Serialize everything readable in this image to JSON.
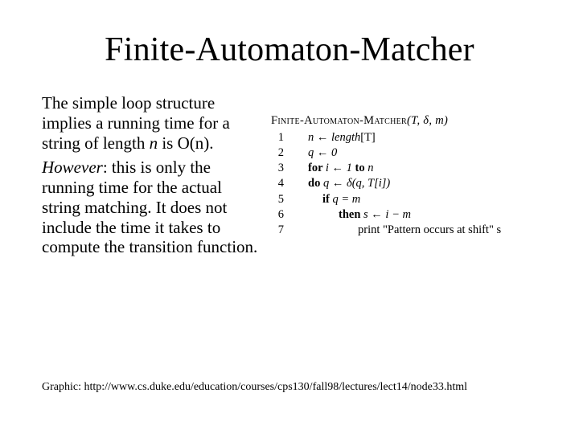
{
  "title": "Finite-Automaton-Matcher",
  "left": {
    "para1_a": "The simple loop structure implies a running time for a string of length ",
    "para1_i": "n",
    "para1_b": " is O(n).",
    "para2_i": "However",
    "para2_b": ": this is only the running time for the actual string matching. It does not include the time it takes to compute the transition function."
  },
  "code": {
    "header_sc": "Finite-Automaton-Matcher",
    "header_args": "(T, δ, m)",
    "lines": {
      "n1": "1",
      "c1a": "n ← ",
      "c1b": "length",
      "c1c": "[T]",
      "n2": "2",
      "c2": "q ← 0",
      "n3": "3",
      "c3a": "for ",
      "c3b": "i ← 1 ",
      "c3c": "to ",
      "c3d": "n",
      "n4": "4",
      "c4a": "do ",
      "c4b": "q ← δ(q, T[i])",
      "n5": "5",
      "c5a": "if ",
      "c5b": "q = m",
      "n6": "6",
      "c6a": "then ",
      "c6b": "s ← i − m",
      "n7": "7",
      "c7a": "print \"Pattern occurs at shift\"  s"
    }
  },
  "footer": "Graphic: http://www.cs.duke.edu/education/courses/cps130/fall98/lectures/lect14/node33.html"
}
